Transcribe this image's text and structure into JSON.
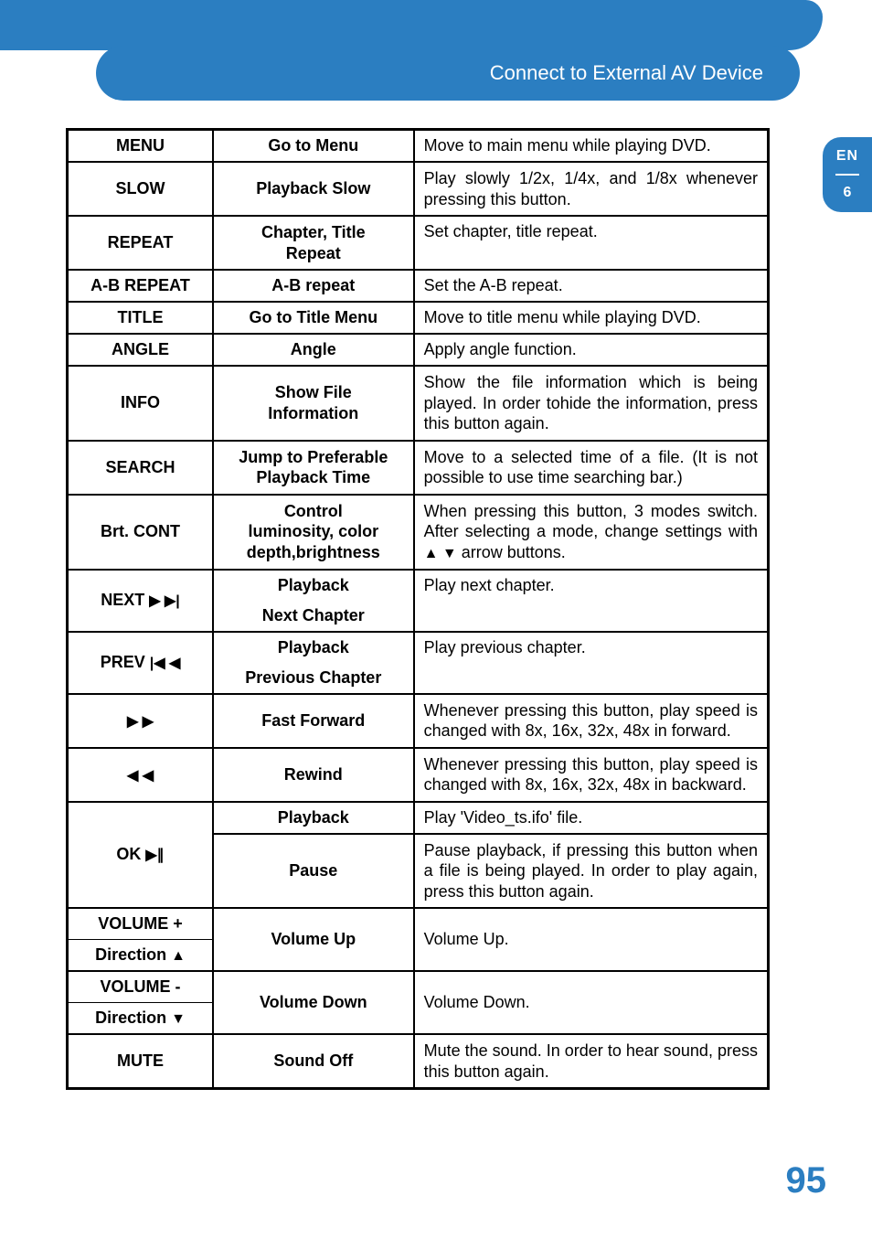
{
  "header": {
    "title": "Connect to External AV Device"
  },
  "sidetab": {
    "lang": "EN",
    "chapter": "6"
  },
  "pagenum": "95",
  "rows": {
    "menu": {
      "key": "MENU",
      "name": "Go to Menu",
      "desc": "Move to main menu while playing DVD."
    },
    "slow": {
      "key": "SLOW",
      "name": "Playback Slow",
      "desc": "Play slowly 1/2x, 1/4x, and 1/8x whenever pressing this button."
    },
    "repeat": {
      "key": "REPEAT",
      "name1": "Chapter, Title",
      "name2": "Repeat",
      "desc": "Set chapter, title repeat."
    },
    "abrepeat": {
      "key": "A-B REPEAT",
      "name": "A-B repeat",
      "desc": "Set the A-B repeat."
    },
    "title": {
      "key": "TITLE",
      "name": "Go to Title Menu",
      "desc": "Move to title menu while playing DVD."
    },
    "angle": {
      "key": "ANGLE",
      "name": "Angle",
      "desc": "Apply angle function."
    },
    "info": {
      "key": "INFO",
      "name1": "Show File",
      "name2": "Information",
      "desc": "Show the file information which is being played. In order tohide the information, press this button again."
    },
    "search": {
      "key": "SEARCH",
      "name1": "Jump to Preferable",
      "name2": "Playback Time",
      "desc": "Move to a selected time of a file. (It is not possible to use time searching bar.)"
    },
    "brtcont": {
      "key": "Brt. CONT",
      "name1": "Control",
      "name2": "luminosity, color",
      "name3": "depth,brightness",
      "desc_pre": "When pressing this button, 3 modes switch. After selecting a mode, change settings with ",
      "desc_post": " arrow buttons."
    },
    "next": {
      "key": "NEXT ",
      "icon": "▶ ▶|",
      "name1": "Playback",
      "name2": "Next Chapter",
      "desc": "Play next chapter."
    },
    "prev": {
      "key": "PREV ",
      "icon": "|◀ ◀",
      "name1": "Playback",
      "name2": "Previous Chapter",
      "desc": "Play previous chapter."
    },
    "ff": {
      "icon": "▶ ▶",
      "name": "Fast Forward",
      "desc": "Whenever pressing this button, play speed is changed with 8x, 16x, 32x, 48x in forward."
    },
    "rew": {
      "icon": "◀ ◀",
      "name": "Rewind",
      "desc": "Whenever pressing this button, play speed is changed with 8x, 16x, 32x, 48x in backward."
    },
    "ok": {
      "key": "OK ",
      "icon": "▶∥",
      "name1": "Playback",
      "name2": "Pause",
      "desc1": "Play 'Video_ts.ifo' file.",
      "desc2": "Pause playback, if pressing this button when a file is being played. In order to play again, press this button again."
    },
    "volup": {
      "key1": "VOLUME +",
      "key2": "Direction ",
      "tri": "▲",
      "name": "Volume Up",
      "desc": "Volume Up."
    },
    "voldown": {
      "key1": "VOLUME -",
      "key2": "Direction ",
      "tri": "▼",
      "name": "Volume Down",
      "desc": "Volume Down."
    },
    "mute": {
      "key": "MUTE",
      "name": "Sound Off",
      "desc": "Mute the sound. In order to hear sound, press this button again."
    }
  }
}
